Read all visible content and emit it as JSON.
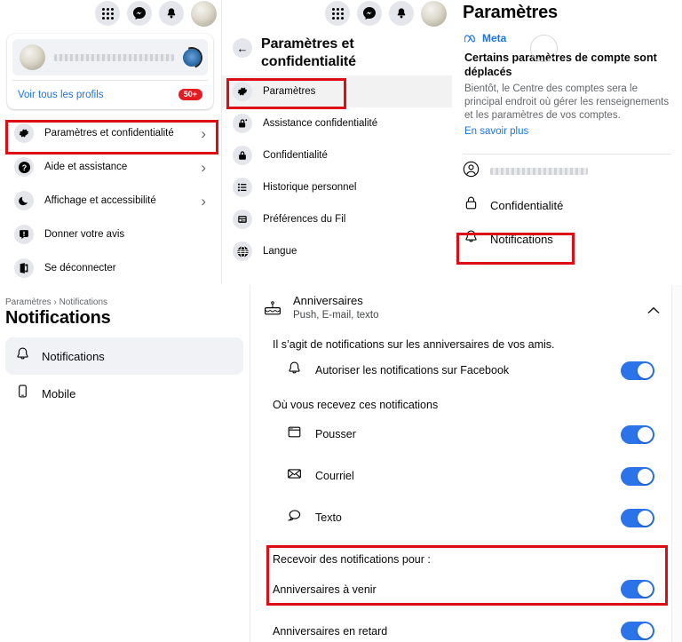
{
  "account_menu": {
    "header_icons": [
      "grid-menu-icon",
      "messenger-icon",
      "bell-icon",
      "avatar"
    ],
    "profile": {
      "name_redacted": "",
      "switch_icon": "switch-profile-icon"
    },
    "all_profiles_label": "Voir tous les profils",
    "all_profiles_badge": "50+",
    "items": [
      {
        "label": "Paramètres et confidentialité",
        "icon": "gear-icon",
        "chevron": "›",
        "highlighted": true
      },
      {
        "label": "Aide et assistance",
        "icon": "question-circle-icon",
        "chevron": "›",
        "highlighted": false
      },
      {
        "label": "Affichage et accessibilité",
        "icon": "moon-icon",
        "chevron": "›",
        "highlighted": false
      },
      {
        "label": "Donner votre avis",
        "icon": "feedback-icon",
        "chevron": "",
        "highlighted": false
      },
      {
        "label": "Se déconnecter",
        "icon": "logout-icon",
        "chevron": "",
        "highlighted": false
      }
    ]
  },
  "settings_menu": {
    "back_icon": "back-arrow-icon",
    "title": "Paramètres et confidentialité",
    "items": [
      {
        "label": "Paramètres",
        "icon": "gear-icon",
        "selected": true
      },
      {
        "label": "Assistance confidentialité",
        "icon": "privacy-checkup-icon",
        "selected": false
      },
      {
        "label": "Confidentialité",
        "icon": "lock-icon",
        "selected": false
      },
      {
        "label": "Historique personnel",
        "icon": "activity-log-icon",
        "selected": false
      },
      {
        "label": "Préférences du Fil",
        "icon": "feed-preferences-icon",
        "selected": false
      },
      {
        "label": "Langue",
        "icon": "globe-icon",
        "selected": false
      }
    ]
  },
  "settings_panel": {
    "title": "Paramètres",
    "meta_card": {
      "brand": "Meta",
      "brand_color": "#1b74e4",
      "title": "Certains paramètres de compte sont déplacés",
      "body": "Bientôt, le Centre des comptes sera le principal endroit où gérer les renseignements et les paramètres de vos comptes.",
      "link": "En savoir plus"
    },
    "nav": [
      {
        "label": "",
        "icon": "account-circle-icon",
        "redacted": true,
        "highlighted": false
      },
      {
        "label": "Confidentialité",
        "icon": "lock-icon",
        "redacted": false,
        "highlighted": false
      },
      {
        "label": "Notifications",
        "icon": "bell-icon",
        "redacted": false,
        "highlighted": true
      }
    ]
  },
  "notifications_nav": {
    "breadcrumb": "Paramètres › Notifications",
    "title": "Notifications",
    "items": [
      {
        "label": "Notifications",
        "icon": "bell-icon",
        "selected": true
      },
      {
        "label": "Mobile",
        "icon": "mobile-phone-icon",
        "selected": false
      }
    ]
  },
  "birthdays": {
    "section_icon": "birthday-cake-icon",
    "section_title": "Anniversaires",
    "section_subtitle": "Push, E-mail, texto",
    "collapse_icon": "chevron-up-icon",
    "description": "Il s’agit de notifications sur les anniversaires de vos amis.",
    "allow_row": {
      "label": "Autoriser les notifications sur Facebook",
      "icon": "bell-icon",
      "on": true
    },
    "where_heading": "Où vous recevez ces notifications",
    "channels": [
      {
        "label": "Pousser",
        "icon": "browser-window-icon",
        "on": true
      },
      {
        "label": "Courriel",
        "icon": "envelope-icon",
        "on": true
      },
      {
        "label": "Texto",
        "icon": "chat-bubble-icon",
        "on": true
      }
    ],
    "receive_heading": "Recevoir des notifications pour :",
    "receive_items": [
      {
        "label": "Anniversaires à venir",
        "on": true,
        "highlighted": true
      },
      {
        "label": "Anniversaires en retard",
        "on": true,
        "highlighted": false
      }
    ]
  },
  "theme": {
    "accent_blue": "#1b74e4",
    "toggle_on": "#2a73e8",
    "highlight_red": "#dc0d15",
    "badge_red": "#e31b23"
  }
}
